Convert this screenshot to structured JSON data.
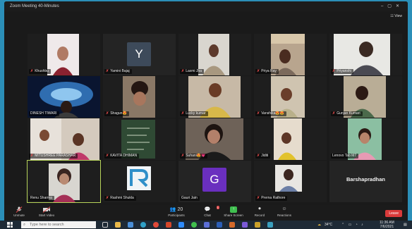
{
  "window": {
    "title": "Zoom Meeting 40-Minutes",
    "view_label": "View"
  },
  "participants": [
    {
      "name": "Khushbu"
    },
    {
      "name": "Yamini Bajaj",
      "initial": "Y",
      "avatar_color": "#3d4a5a"
    },
    {
      "name": "Laxmi Jha"
    },
    {
      "name": "Priya Ray"
    },
    {
      "name": "Priyanshi"
    },
    {
      "name": "DINESH TIWARI"
    },
    {
      "name": "Shagun😍"
    },
    {
      "name": "Lucky kumar"
    },
    {
      "name": "Vanshika😍😍"
    },
    {
      "name": "Gunjan Kumari"
    },
    {
      "name": "MITUSHREE PARASHAR"
    },
    {
      "name": "KAVITA DHIMAN"
    },
    {
      "name": "Suhani😍💗"
    },
    {
      "name": "Jiditi"
    },
    {
      "name": "Lenovo Tab M7"
    },
    {
      "name": "Renu Sharma",
      "active_speaker": true
    },
    {
      "name": "Rashmi Shukla"
    },
    {
      "name": "Gauri Jain",
      "initial": "G",
      "avatar_color": "#6a2fbf"
    },
    {
      "name": "Prerna Rathore"
    },
    {
      "name": "Barshapradhan",
      "video_off_name": "Barshapradhan"
    }
  ],
  "toolbar": {
    "unmute": "Unmute",
    "start_video": "Start Video",
    "participants": "Participants",
    "participants_count": "20",
    "chat": "Chat",
    "chat_badge": "1",
    "share_screen": "Share Screen",
    "record": "Record",
    "reactions": "Reactions",
    "leave": "Leave"
  },
  "taskbar": {
    "search_placeholder": "Type here to search",
    "temperature": "34°C",
    "time": "11:36 AM",
    "date": "7/6/2021"
  },
  "colors": {
    "active_speaker_border": "#b7d45a",
    "leave_button": "#d93a3a",
    "share_screen": "#3fbf4f"
  }
}
